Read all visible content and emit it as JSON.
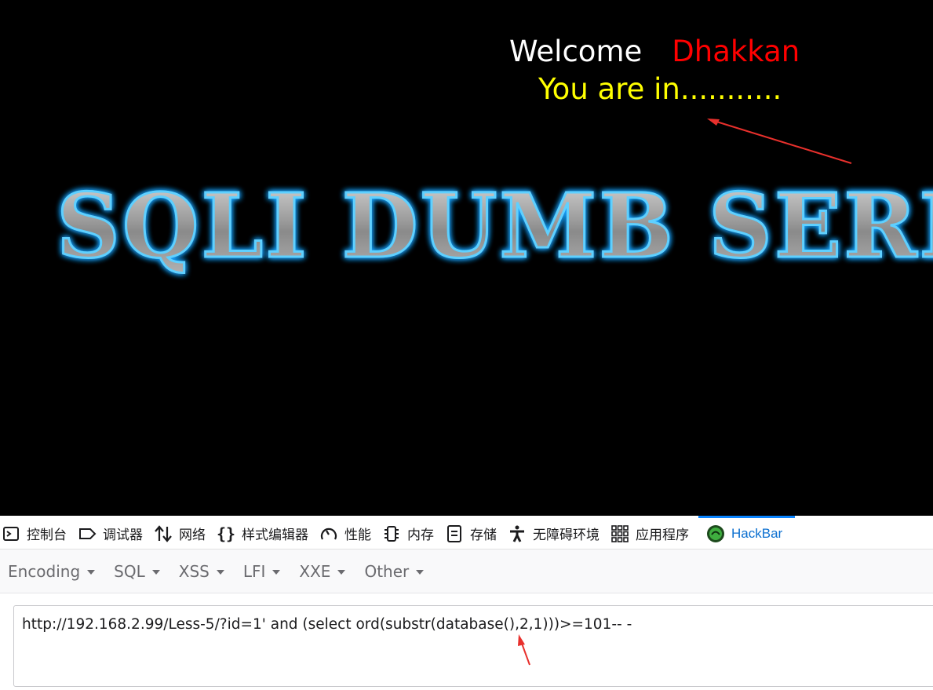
{
  "page": {
    "welcome_label": "Welcome",
    "user_name": "Dhakkan",
    "status_text": "You are in...........",
    "banner_text": "SQLI DUMB SERIES"
  },
  "devtools": {
    "tabs": [
      {
        "label": "控制台",
        "icon": "console-icon"
      },
      {
        "label": "调试器",
        "icon": "debugger-icon"
      },
      {
        "label": "网络",
        "icon": "network-icon"
      },
      {
        "label": "样式编辑器",
        "icon": "style-editor-icon"
      },
      {
        "label": "性能",
        "icon": "performance-icon"
      },
      {
        "label": "内存",
        "icon": "memory-icon"
      },
      {
        "label": "存储",
        "icon": "storage-icon"
      },
      {
        "label": "无障碍环境",
        "icon": "accessibility-icon"
      },
      {
        "label": "应用程序",
        "icon": "application-icon"
      },
      {
        "label": "HackBar",
        "icon": "hackbar-icon",
        "active": true
      }
    ]
  },
  "hackbar": {
    "menus": [
      "Encoding",
      "SQL",
      "XSS",
      "LFI",
      "XXE",
      "Other"
    ],
    "url": "http://192.168.2.99/Less-5/?id=1' and (select ord(substr(database(),2,1)))>=101-- -"
  },
  "colors": {
    "welcome": "#ffffff",
    "user_name": "#ff0000",
    "status": "#ffff00",
    "active_tab": "#0a84ff",
    "annotation": "#e8302c"
  }
}
